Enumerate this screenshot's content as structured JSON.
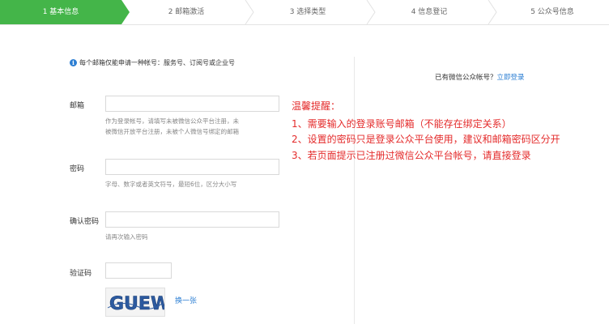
{
  "steps": [
    {
      "label": "1 基本信息",
      "active": true
    },
    {
      "label": "2 邮箱激活",
      "active": false
    },
    {
      "label": "3 选择类型",
      "active": false
    },
    {
      "label": "4 信息登记",
      "active": false
    },
    {
      "label": "5 公众号信息",
      "active": false
    }
  ],
  "notice": "每个邮箱仅能申请一种帐号：服务号、订阅号或企业号",
  "form": {
    "email": {
      "label": "邮箱",
      "value": "",
      "hint_line1": "作为登录帐号，请填写未被微信公众平台注册，未",
      "hint_line2": "被微信开放平台注册，未被个人微信号绑定的邮箱"
    },
    "password": {
      "label": "密码",
      "value": "",
      "hint": "字母、数字或者英文符号，最短6位，区分大小写"
    },
    "confirm": {
      "label": "确认密码",
      "value": "",
      "hint": "请再次输入密码"
    },
    "captcha": {
      "label": "验证码",
      "value": "",
      "image_text": "GUEW",
      "change_label": "换一张"
    }
  },
  "reminder": {
    "title": "温馨提醒：",
    "items": [
      "1、需要输入的登录账号邮箱（不能存在绑定关系）",
      "2、设置的密码只是登录公众平台使用，建议和邮箱密码区分开",
      "3、若页面提示已注册过微信公众平台帐号，请直接登录"
    ]
  },
  "login": {
    "prompt": "已有微信公众帐号？",
    "link": "立即登录"
  },
  "colors": {
    "accent_green": "#44b549",
    "link_blue": "#2d7fd3",
    "reminder_red": "#e42b2b"
  }
}
